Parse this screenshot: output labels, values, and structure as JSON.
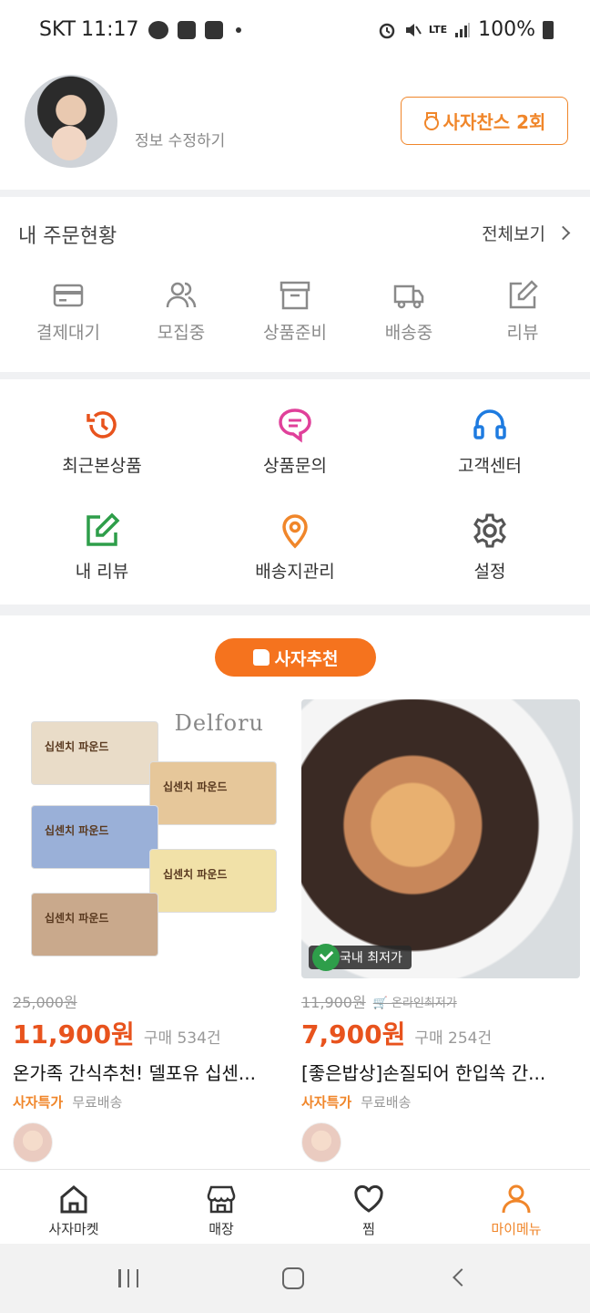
{
  "status_bar": {
    "carrier": "SKT",
    "time": "11:17",
    "network": "LTE",
    "battery": "100%"
  },
  "profile": {
    "edit_label": "정보 수정하기",
    "chance_label": "사자찬스 2회"
  },
  "orders": {
    "title": "내 주문현황",
    "view_all": "전체보기",
    "items": [
      {
        "label": "결제대기",
        "icon": "card-icon"
      },
      {
        "label": "모집중",
        "icon": "users-icon"
      },
      {
        "label": "상품준비",
        "icon": "box-icon"
      },
      {
        "label": "배송중",
        "icon": "truck-icon"
      },
      {
        "label": "리뷰",
        "icon": "edit-icon"
      }
    ]
  },
  "menu": {
    "items": [
      {
        "label": "최근본상품",
        "icon": "history-icon",
        "color": "#e8531d"
      },
      {
        "label": "상품문의",
        "icon": "chat-icon",
        "color": "#e0409a"
      },
      {
        "label": "고객센터",
        "icon": "headset-icon",
        "color": "#1e7be0"
      },
      {
        "label": "내 리뷰",
        "icon": "review-icon",
        "color": "#2e9e4a"
      },
      {
        "label": "배송지관리",
        "icon": "location-icon",
        "color": "#f0862a"
      },
      {
        "label": "설정",
        "icon": "gear-icon",
        "color": "#555555"
      }
    ]
  },
  "recommend": {
    "label": "사자추천"
  },
  "products": [
    {
      "brand": "Delforu",
      "pack_labels": [
        "십센치 파운드",
        "십센치 파운드",
        "십센치 파운드",
        "십센치 파운드",
        "십센치 파운드"
      ],
      "original_price": "25,000원",
      "price": "11,900원",
      "sold": "구매 534건",
      "title": "온가족 간식추천! 델포유 십센...",
      "tag_special": "사자특가",
      "tag_free": "무료배송"
    },
    {
      "badge": "국내 최저가",
      "original_price": "11,900원",
      "online_label": "온라인최저가",
      "price": "7,900원",
      "sold": "구매 254건",
      "title": "[좋은밥상]손질되어 한입쏙 간...",
      "tag_special": "사자특가",
      "tag_free": "무료배송"
    }
  ],
  "bottom_nav": {
    "items": [
      {
        "label": "사자마켓",
        "icon": "home-icon"
      },
      {
        "label": "매장",
        "icon": "store-icon"
      },
      {
        "label": "찜",
        "icon": "heart-icon"
      },
      {
        "label": "마이메뉴",
        "icon": "person-icon"
      }
    ],
    "active_color": "#f0862a"
  }
}
